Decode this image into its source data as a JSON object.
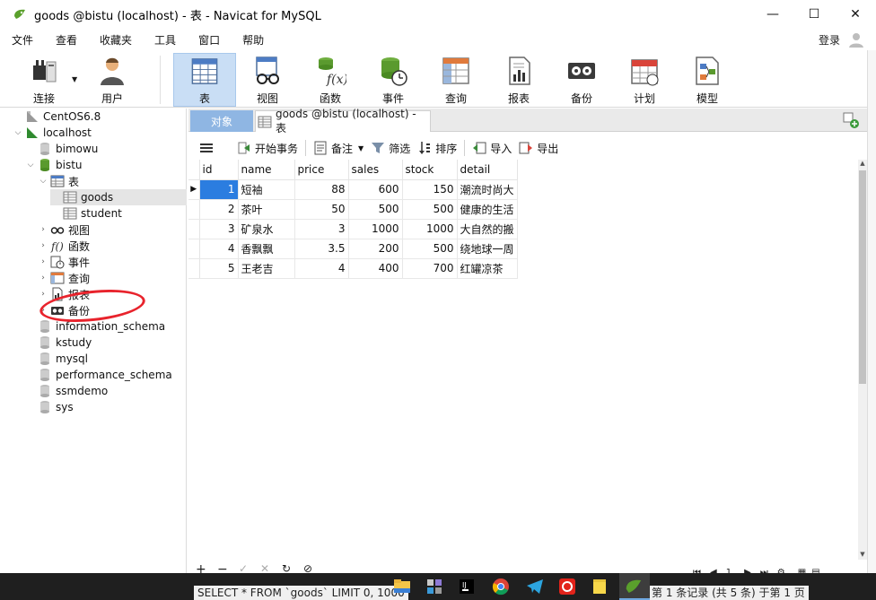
{
  "window": {
    "title": "goods @bistu (localhost) - 表 - Navicat for MySQL",
    "minimize": "—",
    "maximize": "☐",
    "close": "✕"
  },
  "menu": {
    "items": [
      "文件",
      "查看",
      "收藏夹",
      "工具",
      "窗口",
      "帮助"
    ],
    "login": "登录"
  },
  "toolbar": {
    "items": [
      {
        "label": "连接",
        "icon": "connection-icon"
      },
      {
        "label": "用户",
        "icon": "user-icon"
      },
      {
        "label": "表",
        "icon": "table-icon",
        "active": true
      },
      {
        "label": "视图",
        "icon": "view-icon"
      },
      {
        "label": "函数",
        "icon": "function-icon"
      },
      {
        "label": "事件",
        "icon": "event-icon"
      },
      {
        "label": "查询",
        "icon": "query-icon"
      },
      {
        "label": "报表",
        "icon": "report-icon"
      },
      {
        "label": "备份",
        "icon": "backup-icon"
      },
      {
        "label": "计划",
        "icon": "schedule-icon"
      },
      {
        "label": "模型",
        "icon": "model-icon"
      }
    ]
  },
  "sidebar": {
    "items": [
      {
        "label": "CentOS6.8",
        "icon": "connection-grey-icon"
      },
      {
        "label": "localhost",
        "icon": "connection-green-icon"
      },
      {
        "label": "bimowu",
        "icon": "database-grey-icon"
      },
      {
        "label": "bistu",
        "icon": "database-green-icon"
      },
      {
        "label": "表",
        "icon": "tables-folder-icon"
      },
      {
        "label": "goods",
        "icon": "table-icon"
      },
      {
        "label": "student",
        "icon": "table-icon"
      },
      {
        "label": "视图",
        "icon": "views-folder-icon"
      },
      {
        "label": "函数",
        "icon": "functions-folder-icon"
      },
      {
        "label": "事件",
        "icon": "events-folder-icon"
      },
      {
        "label": "查询",
        "icon": "queries-folder-icon"
      },
      {
        "label": "报表",
        "icon": "reports-folder-icon"
      },
      {
        "label": "备份",
        "icon": "backups-folder-icon"
      },
      {
        "label": "information_schema",
        "icon": "database-grey-icon"
      },
      {
        "label": "kstudy",
        "icon": "database-grey-icon"
      },
      {
        "label": "mysql",
        "icon": "database-grey-icon"
      },
      {
        "label": "performance_schema",
        "icon": "database-grey-icon"
      },
      {
        "label": "ssmdemo",
        "icon": "database-grey-icon"
      },
      {
        "label": "sys",
        "icon": "database-grey-icon"
      }
    ]
  },
  "tabs": {
    "objects": "对象",
    "goods": "goods @bistu (localhost) - 表"
  },
  "subtoolbar": {
    "begin_transaction": "开始事务",
    "memo": "备注",
    "filter": "筛选",
    "sort": "排序",
    "import": "导入",
    "export": "导出"
  },
  "grid": {
    "columns": [
      "id",
      "name",
      "price",
      "sales",
      "stock",
      "detail"
    ],
    "rows": [
      [
        "1",
        "短袖",
        "88",
        "600",
        "150",
        "潮流时尚大"
      ],
      [
        "2",
        "茶叶",
        "50",
        "500",
        "500",
        "健康的生活"
      ],
      [
        "3",
        "矿泉水",
        "3",
        "1000",
        "1000",
        "大自然的搬"
      ],
      [
        "4",
        "香飘飘",
        "3.5",
        "200",
        "500",
        "绕地球一周"
      ],
      [
        "5",
        "王老吉",
        "4",
        "400",
        "700",
        "红罐凉茶"
      ]
    ]
  },
  "status": {
    "sql": "SELECT * FROM `goods` LIMIT 0, 1000",
    "records": "第 1 条记录 (共 5 条) 于第 1 页",
    "page": "1"
  }
}
